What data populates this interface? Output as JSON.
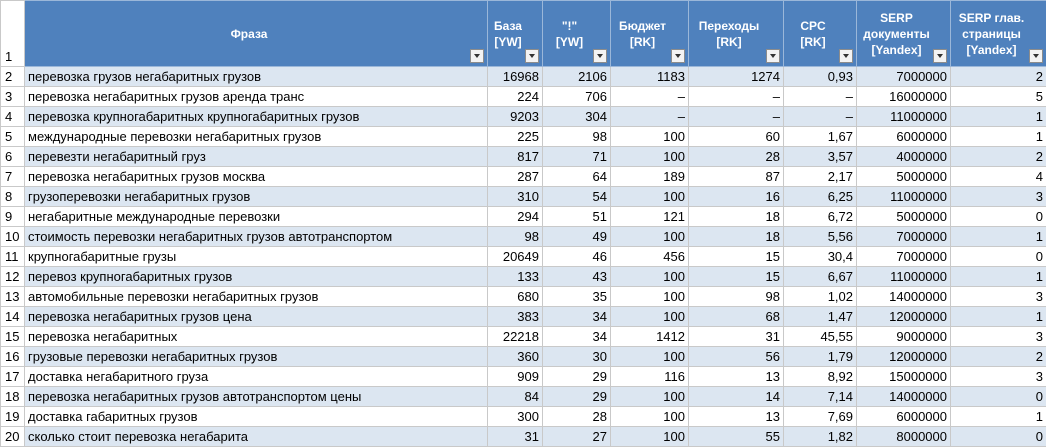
{
  "headers": {
    "row_label": "1",
    "phrase": "Фраза",
    "base": "База [YW]",
    "excl": "\"!\" [YW]",
    "budget": "Бюджет [RK]",
    "clicks": "Переходы [RK]",
    "cpc": "CPC [RK]",
    "serp_docs": "SERP документы [Yandex]",
    "serp_main": "SERP глав. страницы [Yandex]"
  },
  "rows": [
    {
      "n": "2",
      "phrase": "перевозка грузов негабаритных грузов",
      "base": "16968",
      "excl": "2106",
      "budget": "1183",
      "clicks": "1274",
      "cpc": "0,93",
      "serp_docs": "7000000",
      "serp_main": "2"
    },
    {
      "n": "3",
      "phrase": "перевозка негабаритных грузов аренда транс",
      "base": "224",
      "excl": "706",
      "budget": "–",
      "clicks": "–",
      "cpc": "–",
      "serp_docs": "16000000",
      "serp_main": "5"
    },
    {
      "n": "4",
      "phrase": "перевозка крупногабаритных крупногабаритных грузов",
      "base": "9203",
      "excl": "304",
      "budget": "–",
      "clicks": "–",
      "cpc": "–",
      "serp_docs": "11000000",
      "serp_main": "1"
    },
    {
      "n": "5",
      "phrase": "международные перевозки негабаритных грузов",
      "base": "225",
      "excl": "98",
      "budget": "100",
      "clicks": "60",
      "cpc": "1,67",
      "serp_docs": "6000000",
      "serp_main": "1"
    },
    {
      "n": "6",
      "phrase": "перевезти негабаритный груз",
      "base": "817",
      "excl": "71",
      "budget": "100",
      "clicks": "28",
      "cpc": "3,57",
      "serp_docs": "4000000",
      "serp_main": "2"
    },
    {
      "n": "7",
      "phrase": "перевозка негабаритных грузов москва",
      "base": "287",
      "excl": "64",
      "budget": "189",
      "clicks": "87",
      "cpc": "2,17",
      "serp_docs": "5000000",
      "serp_main": "4"
    },
    {
      "n": "8",
      "phrase": "грузоперевозки негабаритных грузов",
      "base": "310",
      "excl": "54",
      "budget": "100",
      "clicks": "16",
      "cpc": "6,25",
      "serp_docs": "11000000",
      "serp_main": "3"
    },
    {
      "n": "9",
      "phrase": "негабаритные международные перевозки",
      "base": "294",
      "excl": "51",
      "budget": "121",
      "clicks": "18",
      "cpc": "6,72",
      "serp_docs": "5000000",
      "serp_main": "0"
    },
    {
      "n": "10",
      "phrase": "стоимость перевозки негабаритных грузов автотранспортом",
      "base": "98",
      "excl": "49",
      "budget": "100",
      "clicks": "18",
      "cpc": "5,56",
      "serp_docs": "7000000",
      "serp_main": "1"
    },
    {
      "n": "11",
      "phrase": "крупногабаритные грузы",
      "base": "20649",
      "excl": "46",
      "budget": "456",
      "clicks": "15",
      "cpc": "30,4",
      "serp_docs": "7000000",
      "serp_main": "0"
    },
    {
      "n": "12",
      "phrase": "перевоз крупногабаритных грузов",
      "base": "133",
      "excl": "43",
      "budget": "100",
      "clicks": "15",
      "cpc": "6,67",
      "serp_docs": "11000000",
      "serp_main": "1"
    },
    {
      "n": "13",
      "phrase": "автомобильные перевозки негабаритных грузов",
      "base": "680",
      "excl": "35",
      "budget": "100",
      "clicks": "98",
      "cpc": "1,02",
      "serp_docs": "14000000",
      "serp_main": "3"
    },
    {
      "n": "14",
      "phrase": "перевозка негабаритных грузов цена",
      "base": "383",
      "excl": "34",
      "budget": "100",
      "clicks": "68",
      "cpc": "1,47",
      "serp_docs": "12000000",
      "serp_main": "1"
    },
    {
      "n": "15",
      "phrase": "перевозка негабаритных",
      "base": "22218",
      "excl": "34",
      "budget": "1412",
      "clicks": "31",
      "cpc": "45,55",
      "serp_docs": "9000000",
      "serp_main": "3"
    },
    {
      "n": "16",
      "phrase": "грузовые перевозки негабаритных грузов",
      "base": "360",
      "excl": "30",
      "budget": "100",
      "clicks": "56",
      "cpc": "1,79",
      "serp_docs": "12000000",
      "serp_main": "2"
    },
    {
      "n": "17",
      "phrase": "доставка негабаритного груза",
      "base": "909",
      "excl": "29",
      "budget": "116",
      "clicks": "13",
      "cpc": "8,92",
      "serp_docs": "15000000",
      "serp_main": "3"
    },
    {
      "n": "18",
      "phrase": "перевозка негабаритных грузов автотранспортом цены",
      "base": "84",
      "excl": "29",
      "budget": "100",
      "clicks": "14",
      "cpc": "7,14",
      "serp_docs": "14000000",
      "serp_main": "0"
    },
    {
      "n": "19",
      "phrase": "доставка габаритных грузов",
      "base": "300",
      "excl": "28",
      "budget": "100",
      "clicks": "13",
      "cpc": "7,69",
      "serp_docs": "6000000",
      "serp_main": "1"
    },
    {
      "n": "20",
      "phrase": "сколько стоит перевозка негабарита",
      "base": "31",
      "excl": "27",
      "budget": "100",
      "clicks": "55",
      "cpc": "1,82",
      "serp_docs": "8000000",
      "serp_main": "0"
    }
  ],
  "theme": {
    "header_bg": "#4f81bd",
    "band_bg": "#dce6f1",
    "filter_icon": "filter-dropdown-icon"
  }
}
